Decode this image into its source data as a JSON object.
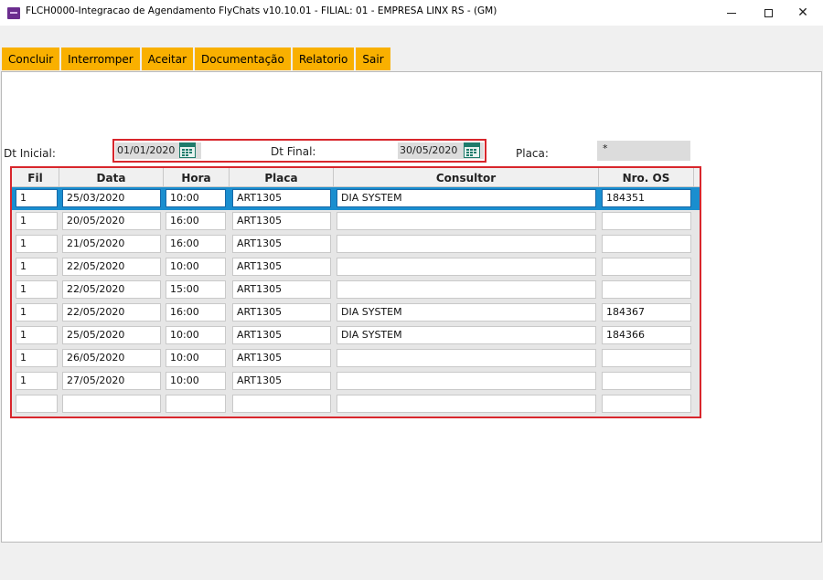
{
  "window": {
    "title": "FLCH0000-Integracao de Agendamento FlyChats v10.10.01   - FILIAL: 01 - EMPRESA LINX RS - (GM)",
    "close_glyph": "✕"
  },
  "toolbar": {
    "buttons": [
      "Concluir",
      "Interromper",
      "Aceitar",
      "Documentação",
      "Relatorio",
      "Sair"
    ]
  },
  "filters": {
    "dt_inicial_label": "Dt Inicial:",
    "dt_inicial_value": "01/01/2020",
    "dt_final_label": "Dt Final:",
    "dt_final_value": "30/05/2020",
    "placa_label": "Placa:",
    "placa_value": "*"
  },
  "grid": {
    "headers": [
      "Fil",
      "Data",
      "Hora",
      "Placa",
      "Consultor",
      "Nro. OS"
    ],
    "rows": [
      {
        "fil": "1",
        "data": "25/03/2020",
        "hora": "10:00",
        "placa": "ART1305",
        "consultor": "DIA SYSTEM",
        "nro_os": "184351"
      },
      {
        "fil": "1",
        "data": "20/05/2020",
        "hora": "16:00",
        "placa": "ART1305",
        "consultor": "",
        "nro_os": ""
      },
      {
        "fil": "1",
        "data": "21/05/2020",
        "hora": "16:00",
        "placa": "ART1305",
        "consultor": "",
        "nro_os": ""
      },
      {
        "fil": "1",
        "data": "22/05/2020",
        "hora": "10:00",
        "placa": "ART1305",
        "consultor": "",
        "nro_os": ""
      },
      {
        "fil": "1",
        "data": "22/05/2020",
        "hora": "15:00",
        "placa": "ART1305",
        "consultor": "",
        "nro_os": ""
      },
      {
        "fil": "1",
        "data": "22/05/2020",
        "hora": "16:00",
        "placa": "ART1305",
        "consultor": "DIA SYSTEM",
        "nro_os": "184367"
      },
      {
        "fil": "1",
        "data": "25/05/2020",
        "hora": "10:00",
        "placa": "ART1305",
        "consultor": "DIA SYSTEM",
        "nro_os": "184366"
      },
      {
        "fil": "1",
        "data": "26/05/2020",
        "hora": "10:00",
        "placa": "ART1305",
        "consultor": "",
        "nro_os": ""
      },
      {
        "fil": "1",
        "data": "27/05/2020",
        "hora": "10:00",
        "placa": "ART1305",
        "consultor": "",
        "nro_os": ""
      },
      {
        "fil": "",
        "data": "",
        "hora": "",
        "placa": "",
        "consultor": "",
        "nro_os": ""
      }
    ],
    "selected_row": 0
  },
  "colors": {
    "tab_bg": "#f9b000",
    "highlight_border": "#d8262c",
    "selected_row": "#1a8ecf"
  }
}
